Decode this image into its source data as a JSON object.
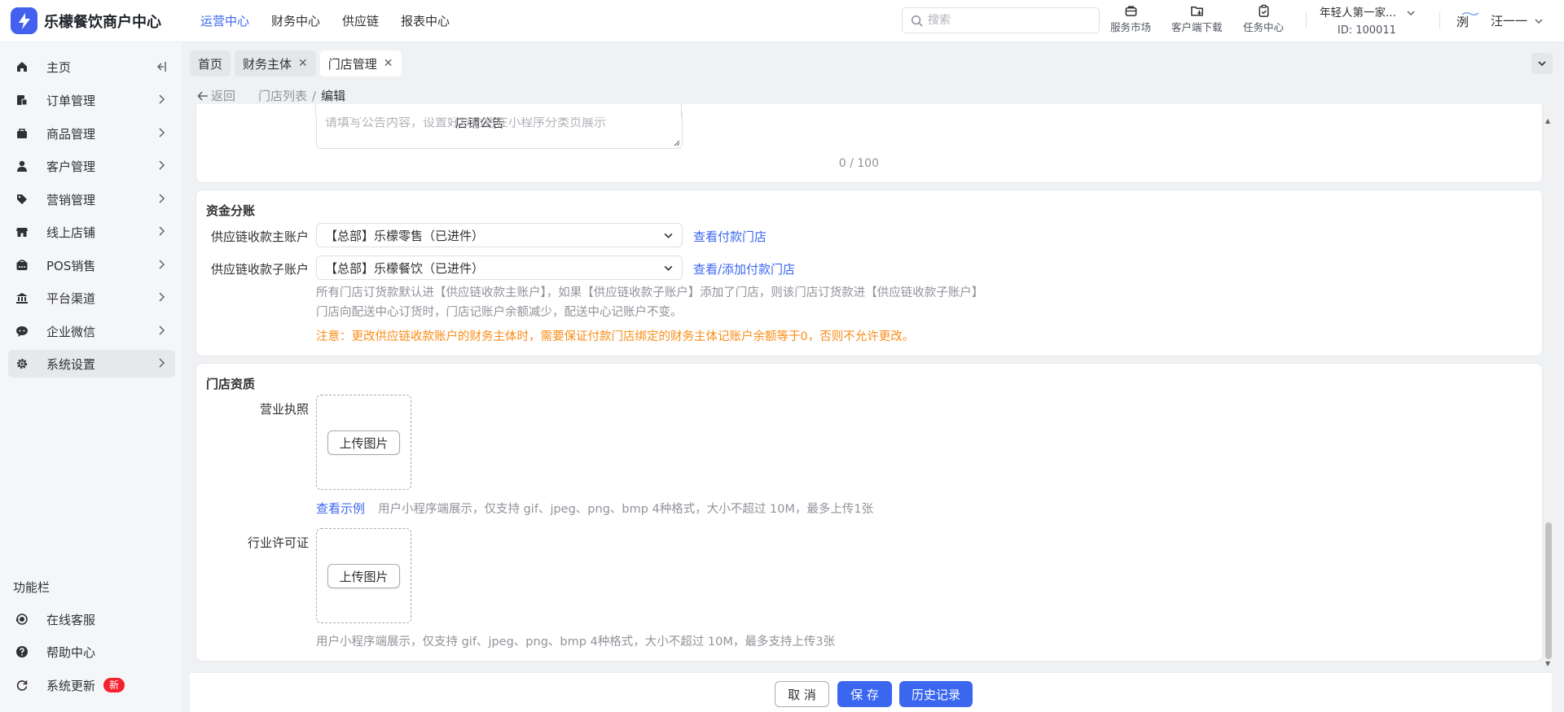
{
  "header": {
    "app_title": "乐檬餐饮商户中心",
    "nav": [
      "运营中心",
      "财务中心",
      "供应链",
      "报表中心"
    ],
    "active_nav": 0,
    "search_placeholder": "搜索",
    "tools": [
      {
        "label": "服务市场",
        "icon": "shop-bag-icon"
      },
      {
        "label": "客户端下载",
        "icon": "download-folder-icon"
      },
      {
        "label": "任务中心",
        "icon": "clipboard-check-icon"
      }
    ],
    "store_name": "年轻人第一家...",
    "store_id": "ID: 100011",
    "avatar_text": "洌",
    "user_name": "汪一一"
  },
  "sidebar": {
    "items": [
      {
        "label": "主页",
        "icon": "home-icon"
      },
      {
        "label": "订单管理",
        "icon": "order-icon"
      },
      {
        "label": "商品管理",
        "icon": "product-icon"
      },
      {
        "label": "客户管理",
        "icon": "user-icon"
      },
      {
        "label": "营销管理",
        "icon": "tag-icon"
      },
      {
        "label": "线上店铺",
        "icon": "store-icon"
      },
      {
        "label": "POS销售",
        "icon": "pos-icon"
      },
      {
        "label": "平台渠道",
        "icon": "bank-icon"
      },
      {
        "label": "企业微信",
        "icon": "wechat-icon"
      },
      {
        "label": "系统设置",
        "icon": "gear-icon"
      }
    ],
    "active_index": 9,
    "section_title": "功能栏",
    "bottom_items": [
      {
        "label": "在线客服",
        "icon": "headset-icon"
      },
      {
        "label": "帮助中心",
        "icon": "help-icon"
      },
      {
        "label": "系统更新",
        "icon": "refresh-icon",
        "badge": "新"
      }
    ]
  },
  "tabs": [
    {
      "label": "首页",
      "closable": false
    },
    {
      "label": "财务主体",
      "closable": true
    },
    {
      "label": "门店管理",
      "closable": true,
      "active": true
    }
  ],
  "breadcrumb": {
    "back": "返回",
    "parent": "门店列表",
    "current": "编辑"
  },
  "announcement": {
    "label": "店铺公告",
    "placeholder": "请填写公告内容，设置好以后将在小程序分类页展示",
    "counter": "0 / 100"
  },
  "funds": {
    "title": "资金分账",
    "main_account_label": "供应链收款主账户",
    "main_account_value": "【总部】乐檬零售（已进件）",
    "main_account_link": "查看付款门店",
    "sub_account_label": "供应链收款子账户",
    "sub_account_value": "【总部】乐檬餐饮（已进件）",
    "sub_account_link": "查看/添加付款门店",
    "hint1": "所有门店订货款默认进【供应链收款主账户】，如果【供应链收款子账户】添加了门店，则该门店订货款进【供应链收款子账户】",
    "hint2": "门店向配送中心订货时，门店记账户余额减少，配送中心记账户不变。",
    "warning": "注意：更改供应链收款账户的财务主体时，需要保证付款门店绑定的财务主体记账户余额等于0，否则不允许更改。"
  },
  "qualification": {
    "title": "门店资质",
    "license_label": "营业执照",
    "upload_label": "上传图片",
    "example_link": "查看示例",
    "license_hint": "用户小程序端展示，仅支持 gif、jpeg、png、bmp 4种格式，大小不超过 10M，最多上传1张",
    "permit_label": "行业许可证",
    "permit_hint": "用户小程序端展示，仅支持 gif、jpeg、png、bmp 4种格式，大小不超过 10M，最多支持上传3张"
  },
  "footer": {
    "cancel": "取 消",
    "save": "保 存",
    "history": "历史记录"
  },
  "colors": {
    "primary": "#3a66f0",
    "warning": "#fa8c16",
    "badge": "#f5222d"
  }
}
